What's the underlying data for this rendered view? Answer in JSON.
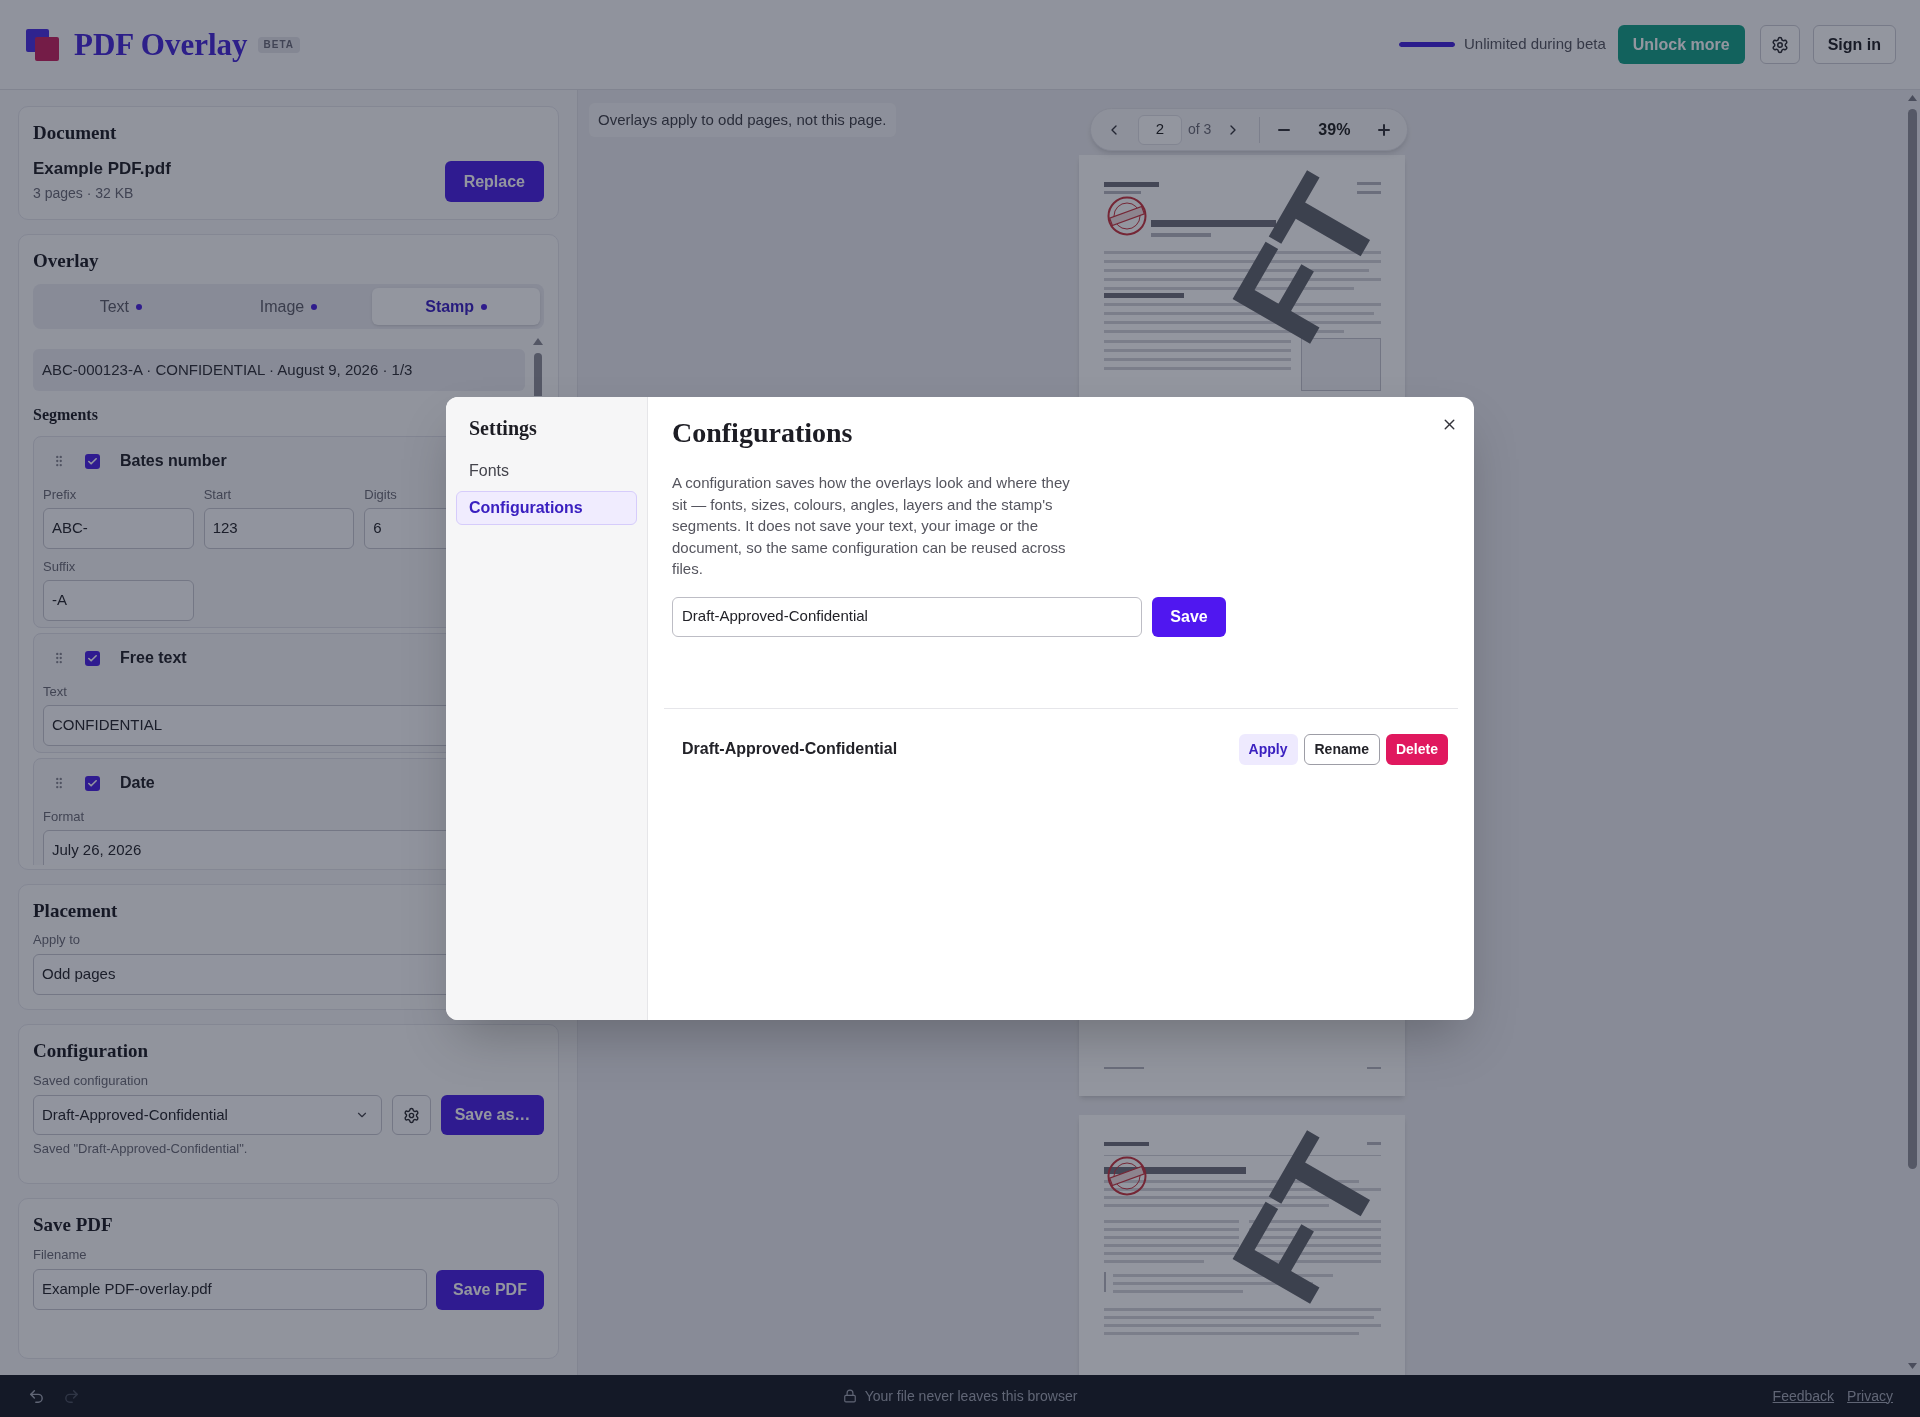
{
  "header": {
    "title": "PDF Overlay",
    "badge": "BETA",
    "usage": {
      "level": 1,
      "label": "Unlimited during beta"
    },
    "unlock_button": "Unlock more",
    "sign_in_button": "Sign in"
  },
  "sidebar": {
    "document": {
      "heading": "Document",
      "file_name": "Example PDF.pdf",
      "file_info": "3 pages · 32 KB",
      "replace_button": "Replace"
    },
    "overlay": {
      "heading": "Overlay",
      "tabs": [
        {
          "label": "Text",
          "selected": false,
          "enabled": true
        },
        {
          "label": "Image",
          "selected": false,
          "enabled": true
        },
        {
          "label": "Stamp",
          "selected": true,
          "enabled": true
        }
      ],
      "stamp_preview": "ABC-000123-A · CONFIDENTIAL · August 9, 2026 · 1/3",
      "segments_heading": "Segments",
      "segments": [
        {
          "title": "Bates number",
          "checked": true,
          "fields": [
            {
              "label": "Prefix",
              "value": "ABC-"
            },
            {
              "label": "Start",
              "value": "123"
            },
            {
              "label": "Digits",
              "value": "6"
            },
            {
              "label": "Suffix",
              "value": "-A"
            }
          ]
        },
        {
          "title": "Free text",
          "checked": true,
          "fields": [
            {
              "label": "Text",
              "value": "CONFIDENTIAL"
            }
          ]
        },
        {
          "title": "Date",
          "checked": true,
          "fields": [
            {
              "label": "Format",
              "value": "July 26, 2026"
            }
          ]
        }
      ]
    },
    "placement": {
      "heading": "Placement",
      "apply_to_label": "Apply to",
      "apply_to_value": "Odd pages"
    },
    "configuration": {
      "heading": "Configuration",
      "saved_label": "Saved configuration",
      "saved_value": "Draft-Approved-Confidential",
      "save_as_button": "Save as…",
      "status": "Saved \"Draft-Approved-Confidential\"."
    },
    "save_pdf": {
      "heading": "Save PDF",
      "filename_label": "Filename",
      "filename_value": "Example PDF-overlay.pdf",
      "save_button": "Save PDF"
    }
  },
  "preview": {
    "notice": "Overlays apply to odd pages, not this page.",
    "page_number": "2",
    "page_total": "of 3",
    "zoom": "39%",
    "pages": [
      {
        "kind": "overlaid",
        "watermark": "FT"
      },
      {
        "kind": "plain"
      },
      {
        "kind": "overlaid",
        "watermark": "FT"
      }
    ]
  },
  "footer": {
    "undo_disabled": false,
    "redo_disabled": true,
    "note": "Your file never leaves this browser",
    "links": [
      "Feedback",
      "Privacy"
    ]
  },
  "settings_dialog": {
    "nav_title": "Settings",
    "nav_items": [
      {
        "label": "Fonts",
        "selected": false
      },
      {
        "label": "Configurations",
        "selected": true
      }
    ],
    "title": "Configurations",
    "description": "A configuration saves how the overlays look and where they sit — fonts, sizes, colours, angles, layers and the stamp's segments. It does not save your text, your image or the document, so the same configuration can be reused across files.",
    "name_value": "Draft-Approved-Confidential",
    "save_button": "Save",
    "saved_configs": [
      {
        "name": "Draft-Approved-Confidential",
        "actions": [
          {
            "label": "Apply",
            "kind": "apply"
          },
          {
            "label": "Rename",
            "kind": "rename"
          },
          {
            "label": "Delete",
            "kind": "delete"
          }
        ]
      }
    ]
  }
}
